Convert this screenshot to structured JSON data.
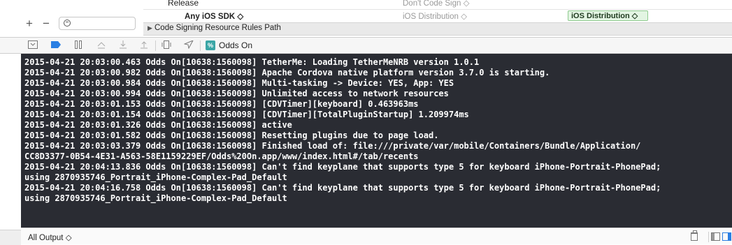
{
  "build_settings": {
    "row1_label": "Release",
    "row1_value": "Don't Code Sign ◇",
    "row2_label": "Any iOS SDK ◇",
    "row2_value": "iOS Distribution ◇",
    "row2_badge": "iOS Distribution ◇",
    "row3_disclosure": "▶",
    "row3_label": "Code Signing Resource Rules Path"
  },
  "left_pane": {
    "add_label": "+",
    "remove_label": "−"
  },
  "toolbar": {
    "target_app": "Odds On",
    "target_icon_text": "%"
  },
  "console": {
    "lines": [
      "2015-04-21 20:03:00.463 Odds On[10638:1560098] TetherMe: Loading TetherMeNRB version 1.0.1",
      "2015-04-21 20:03:00.982 Odds On[10638:1560098] Apache Cordova native platform version 3.7.0 is starting.",
      "2015-04-21 20:03:00.984 Odds On[10638:1560098] Multi-tasking -> Device: YES, App: YES",
      "2015-04-21 20:03:00.994 Odds On[10638:1560098] Unlimited access to network resources",
      "2015-04-21 20:03:01.153 Odds On[10638:1560098] [CDVTimer][keyboard] 0.463963ms",
      "2015-04-21 20:03:01.154 Odds On[10638:1560098] [CDVTimer][TotalPluginStartup] 1.209974ms",
      "2015-04-21 20:03:01.326 Odds On[10638:1560098] active",
      "2015-04-21 20:03:01.582 Odds On[10638:1560098] Resetting plugins due to page load.",
      "2015-04-21 20:03:03.379 Odds On[10638:1560098] Finished load of: file:///private/var/mobile/Containers/Bundle/Application/",
      "CC8D3377-0B54-4E31-A563-58E1159229EF/Odds%20On.app/www/index.html#/tab/recents",
      "2015-04-21 20:04:13.836 Odds On[10638:1560098] Can't find keyplane that supports type 5 for keyboard iPhone-Portrait-PhonePad;",
      "using 2870935746_Portrait_iPhone-Complex-Pad_Default",
      "2015-04-21 20:04:16.758 Odds On[10638:1560098] Can't find keyplane that supports type 5 for keyboard iPhone-Portrait-PhonePad;",
      "using 2870935746_Portrait_iPhone-Complex-Pad_Default"
    ]
  },
  "bottom_bar": {
    "output_filter": "All Output ◇"
  },
  "colors": {
    "console_bg": "#2a2c33",
    "console_text": "#ffffff",
    "badge_bg": "#e3f5e3",
    "active_blue": "#2a7fe3"
  }
}
